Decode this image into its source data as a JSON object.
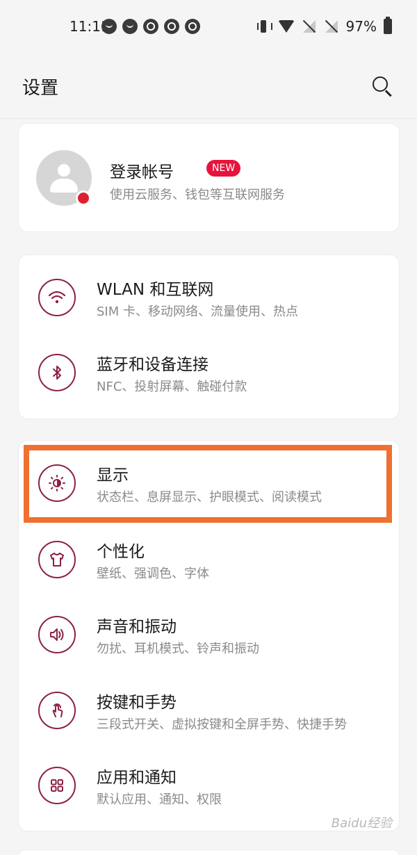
{
  "status_bar": {
    "time": "11:11",
    "notifications": [
      "round",
      "round",
      "q",
      "q",
      "q"
    ],
    "battery": "97%",
    "icons": [
      "vibrate-icon",
      "wifi-icon",
      "no-signal-icon",
      "no-signal-icon",
      "battery-icon"
    ]
  },
  "header": {
    "title": "设置",
    "search_icon": "search-icon"
  },
  "account": {
    "title": "登录帐号",
    "badge": "NEW",
    "subtitle": "使用云服务、钱包等互联网服务"
  },
  "groups": [
    {
      "items": [
        {
          "title": "WLAN 和互联网",
          "subtitle": "SIM 卡、移动网络、流量使用、热点",
          "icon": "wifi-icon"
        },
        {
          "title": "蓝牙和设备连接",
          "subtitle": "NFC、投射屏幕、触碰付款",
          "icon": "bluetooth-icon"
        }
      ]
    },
    {
      "items": [
        {
          "title": "显示",
          "subtitle": "状态栏、息屏显示、护眼模式、阅读模式",
          "icon": "brightness-icon"
        },
        {
          "title": "个性化",
          "subtitle": "壁纸、强调色、字体",
          "icon": "tshirt-icon"
        },
        {
          "title": "声音和振动",
          "subtitle": "勿扰、耳机模式、铃声和振动",
          "icon": "speaker-icon"
        },
        {
          "title": "按键和手势",
          "subtitle": "三段式开关、虚拟按键和全屏手势、快捷手势",
          "icon": "gesture-icon"
        },
        {
          "title": "应用和通知",
          "subtitle": "默认应用、通知、权限",
          "icon": "apps-icon"
        }
      ]
    }
  ],
  "watermark": "Baidu经验",
  "colors": {
    "accent": "#8c2048",
    "badge": "#e6143c",
    "highlight": "#f07030",
    "background": "#f5f5f5"
  }
}
